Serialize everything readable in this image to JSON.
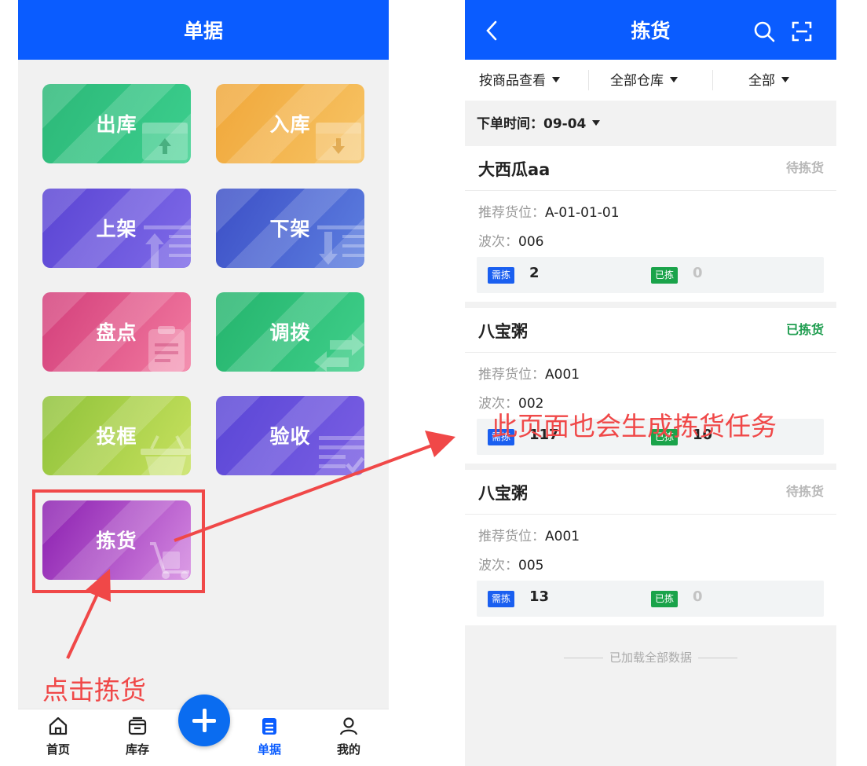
{
  "left_screen": {
    "title": "单据",
    "tiles": [
      {
        "label": "出库",
        "icon": "box-upload-icon",
        "from": "#2cb878",
        "to": "#3ccf8e"
      },
      {
        "label": "入库",
        "icon": "box-download-icon",
        "from": "#f0a73a",
        "to": "#f7c465"
      },
      {
        "label": "上架",
        "icon": "shelf-up-icon",
        "from": "#5a44d3",
        "to": "#7f6be8"
      },
      {
        "label": "下架",
        "icon": "shelf-down-icon",
        "from": "#3c4fc6",
        "to": "#5d7fe0"
      },
      {
        "label": "盘点",
        "icon": "clipboard-icon",
        "from": "#d33f7b",
        "to": "#f27aa0"
      },
      {
        "label": "调拨",
        "icon": "transfer-arrows-icon",
        "from": "#25b46d",
        "to": "#3fcf8a"
      },
      {
        "label": "投框",
        "icon": "basket-icon",
        "from": "#8fc23a",
        "to": "#c7e15e"
      },
      {
        "label": "验收",
        "icon": "checklist-icon",
        "from": "#5a46d6",
        "to": "#7a5fe3"
      },
      {
        "label": "拣货",
        "icon": "hand-truck-icon",
        "from": "#8b1fb0",
        "to": "#d487e0"
      }
    ],
    "tabbar": [
      {
        "label": "首页",
        "icon": "home-icon",
        "active": false
      },
      {
        "label": "库存",
        "icon": "inventory-box-icon",
        "active": false
      },
      {
        "label": "单据",
        "icon": "document-icon",
        "active": true
      },
      {
        "label": "我的",
        "icon": "user-icon",
        "active": false
      }
    ],
    "fab_icon": "plus-icon",
    "annotation": "点击拣货"
  },
  "right_screen": {
    "title": "拣货",
    "filters": [
      "按商品查看",
      "全部仓库",
      "全部"
    ],
    "date_filter": {
      "label": "下单时间：",
      "value": "09-04"
    },
    "annotation": "此页面也会生成拣货任务",
    "labels": {
      "location": "推荐货位：",
      "batch": "波次：",
      "need": "需拣",
      "picked": "已拣"
    },
    "cards": [
      {
        "name": "大西瓜aa",
        "status": "待拣货",
        "done": false,
        "location": "A-01-01-01",
        "batch": "006",
        "need": "2",
        "picked": "0"
      },
      {
        "name": "八宝粥",
        "status": "已拣货",
        "done": true,
        "location": "A001",
        "batch": "002",
        "need": "117",
        "picked": "10"
      },
      {
        "name": "八宝粥",
        "status": "待拣货",
        "done": false,
        "location": "A001",
        "batch": "005",
        "need": "13",
        "picked": "0"
      }
    ],
    "footer": "已加载全部数据"
  },
  "colors": {
    "brand_blue": "#0a5cff",
    "annotation_red": "#f04848",
    "done_green": "#1e9d4f"
  }
}
